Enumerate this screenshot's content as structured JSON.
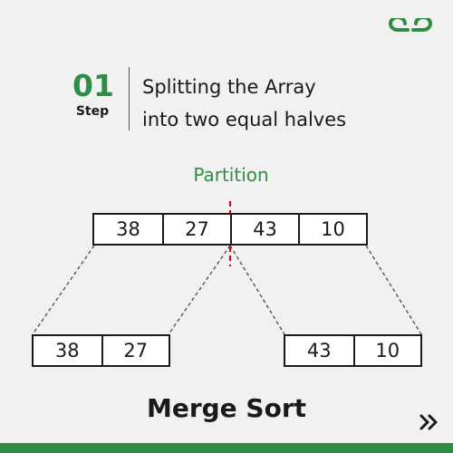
{
  "brand": {
    "logo_icon": "gfg-logo-icon",
    "accent_color": "#2f8d46"
  },
  "step": {
    "number": "01",
    "label": "Step",
    "title_line1": "Splitting the Array",
    "title_line2": "into two equal halves"
  },
  "partition_label": "Partition",
  "array": {
    "full": [
      "38",
      "27",
      "43",
      "10"
    ],
    "left_half": [
      "38",
      "27"
    ],
    "right_half": [
      "43",
      "10"
    ]
  },
  "footer": {
    "title": "Merge Sort",
    "next_icon": "double-chevron-right-icon"
  }
}
